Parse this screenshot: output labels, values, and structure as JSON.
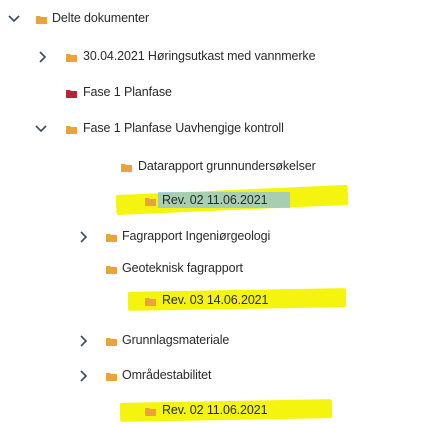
{
  "tree": {
    "root": {
      "label": "Delte dokumenter",
      "expanded": true,
      "folder_color": "#e8a33a"
    },
    "items": [
      {
        "label": "30.04.2021 Høringsutkast med vannmerke",
        "expanded": false,
        "folder_color": "#e8a33a"
      },
      {
        "label": "Fase 1 Planfase",
        "expanded": null,
        "folder_color": "#b3263a"
      },
      {
        "label": "Fase 1 Planfase Uavhengige kontroll",
        "expanded": true,
        "folder_color": "#e8a33a"
      },
      {
        "label": "Datarapport grunnundersøkelser",
        "expanded": null,
        "folder_color": "#e8a33a"
      },
      {
        "label": "Rev. 02 11.06.2021",
        "expanded": null,
        "folder_color": "#e8a33a",
        "highlight": "#f4f40f",
        "selected": true
      },
      {
        "label": "Fagrapport Ingeniørgeologi",
        "expanded": false,
        "folder_color": "#e8a33a"
      },
      {
        "label": "Geoteknisk fagrapport",
        "expanded": null,
        "folder_color": "#e8a33a"
      },
      {
        "label": "Rev. 03 14.06.2021",
        "expanded": null,
        "folder_color": "#e8a33a",
        "highlight": "#f4f40f"
      },
      {
        "label": "Grunnlagsmateriale",
        "expanded": false,
        "folder_color": "#e8a33a"
      },
      {
        "label": "Områdestabilitet",
        "expanded": false,
        "folder_color": "#e8a33a"
      },
      {
        "label": "Rev. 02 11.06.2021",
        "expanded": null,
        "folder_color": "#e8a33a",
        "highlight": "#f4f40f"
      }
    ]
  },
  "icons": {
    "expanded": "chevron-down-icon",
    "collapsed": "chevron-right-icon",
    "folder": "folder-icon"
  }
}
